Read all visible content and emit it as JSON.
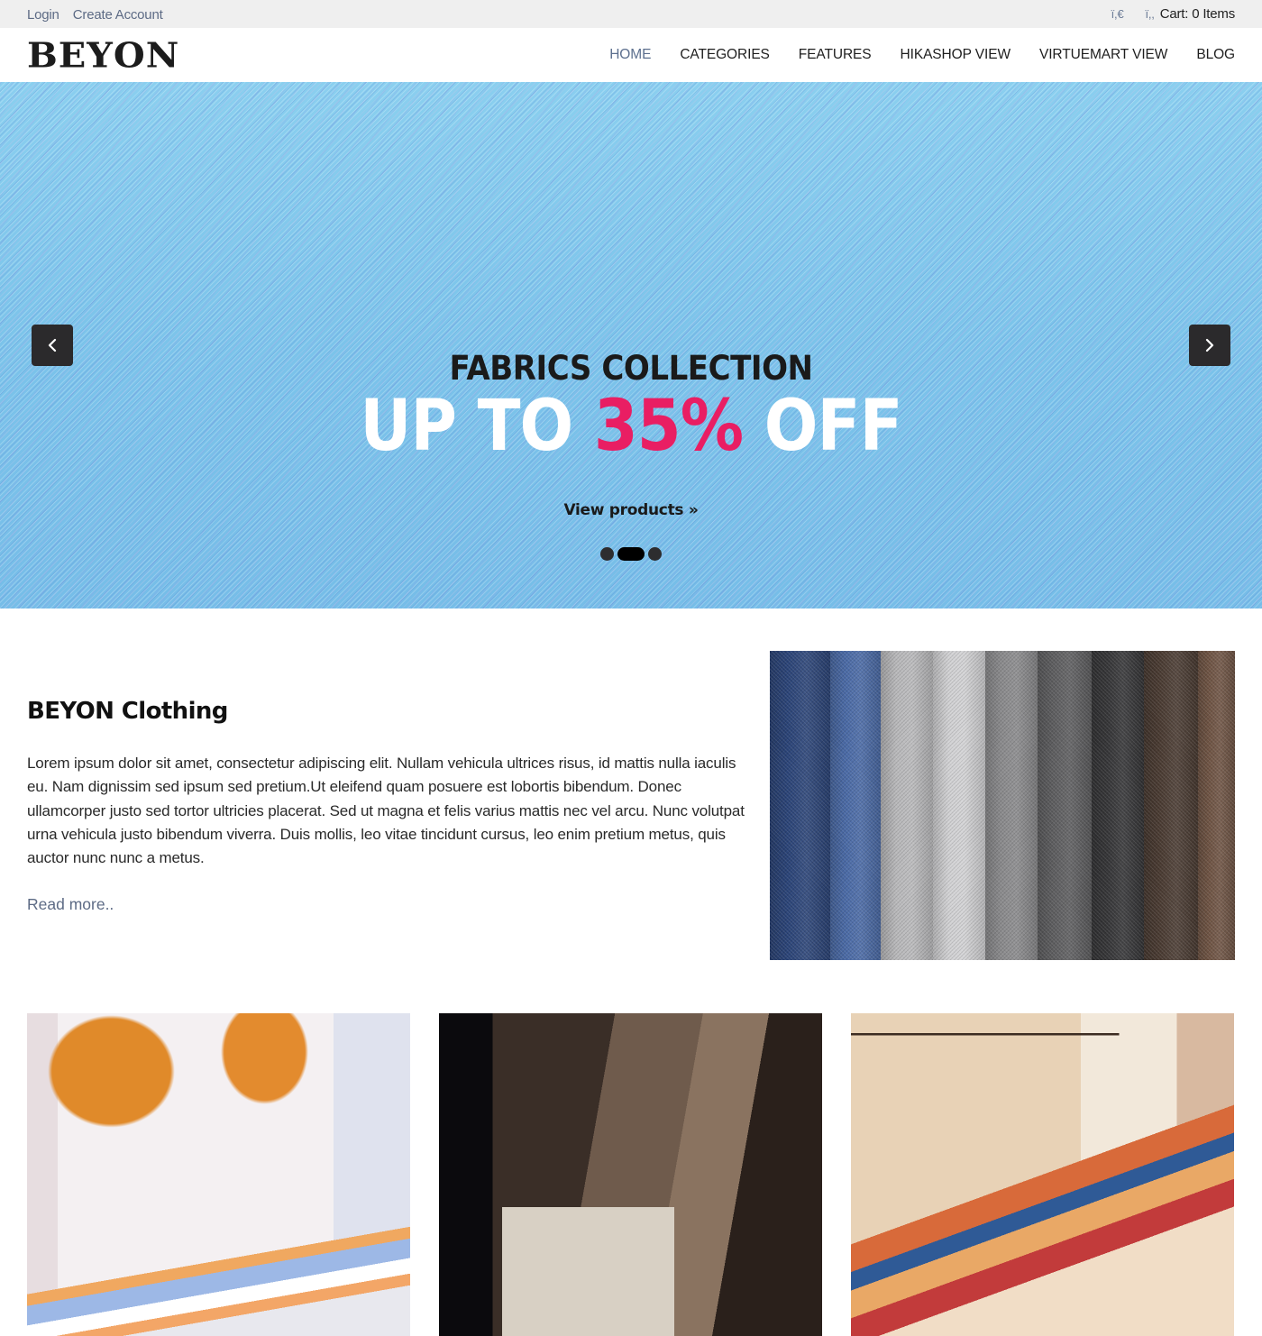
{
  "topbar": {
    "login_label": "Login",
    "create_account_label": "Create Account",
    "currency_glyph": "ï,€",
    "cart_glyph": "ï,,",
    "cart_label": "Cart: 0 Items"
  },
  "header": {
    "logo": "BEYON",
    "nav": [
      {
        "label": "HOME",
        "active": true
      },
      {
        "label": "CATEGORIES",
        "active": false
      },
      {
        "label": "FEATURES",
        "active": false
      },
      {
        "label": "HIKASHOP VIEW",
        "active": false
      },
      {
        "label": "VIRTUEMART VIEW",
        "active": false
      },
      {
        "label": "BLOG",
        "active": false
      }
    ]
  },
  "hero": {
    "kicker": "FABRICS COLLECTION",
    "title_prefix": "UP TO ",
    "title_accent": "35%",
    "title_suffix": " OFF",
    "cta_label": "View products »",
    "prev_icon": "chevron-left-icon",
    "next_icon": "chevron-right-icon",
    "slides_total": 3,
    "active_slide": 2,
    "accent_color": "#e91e63"
  },
  "about": {
    "title": "BEYON Clothing",
    "body": "Lorem ipsum dolor sit amet, consectetur adipiscing elit. Nullam vehicula ultrices risus, id mattis nulla iaculis eu. Nam dignissim sed ipsum sed pretium.Ut eleifend quam posuere est lobortis bibendum. Donec ullamcorper justo sed tortor ultricies placerat. Sed ut magna et felis varius mattis nec vel arcu. Nunc volutpat urna vehicula justo bibendum viverra. Duis mollis, leo vitae tincidunt cursus, leo enim pretium metus, quis auctor nunc nunc a metus.",
    "read_more_label": "Read more..",
    "image_alt": "fabric swatches",
    "swatch_colors": [
      "#2b4478",
      "#4a6aa6",
      "#b9b9bb",
      "#d2d2d4",
      "#8a8a8c",
      "#5e5e60",
      "#363638",
      "#4a3b32",
      "#6f5444"
    ]
  },
  "gallery": [
    {
      "alt": "white dress on orange hangers"
    },
    {
      "alt": "canvas tote bags hanging"
    },
    {
      "alt": "patterned clothes on wooden hangers"
    }
  ],
  "colors": {
    "link": "#5d6b85",
    "topbar_bg": "#efefef",
    "arrow_bg": "#2b2a2c"
  }
}
